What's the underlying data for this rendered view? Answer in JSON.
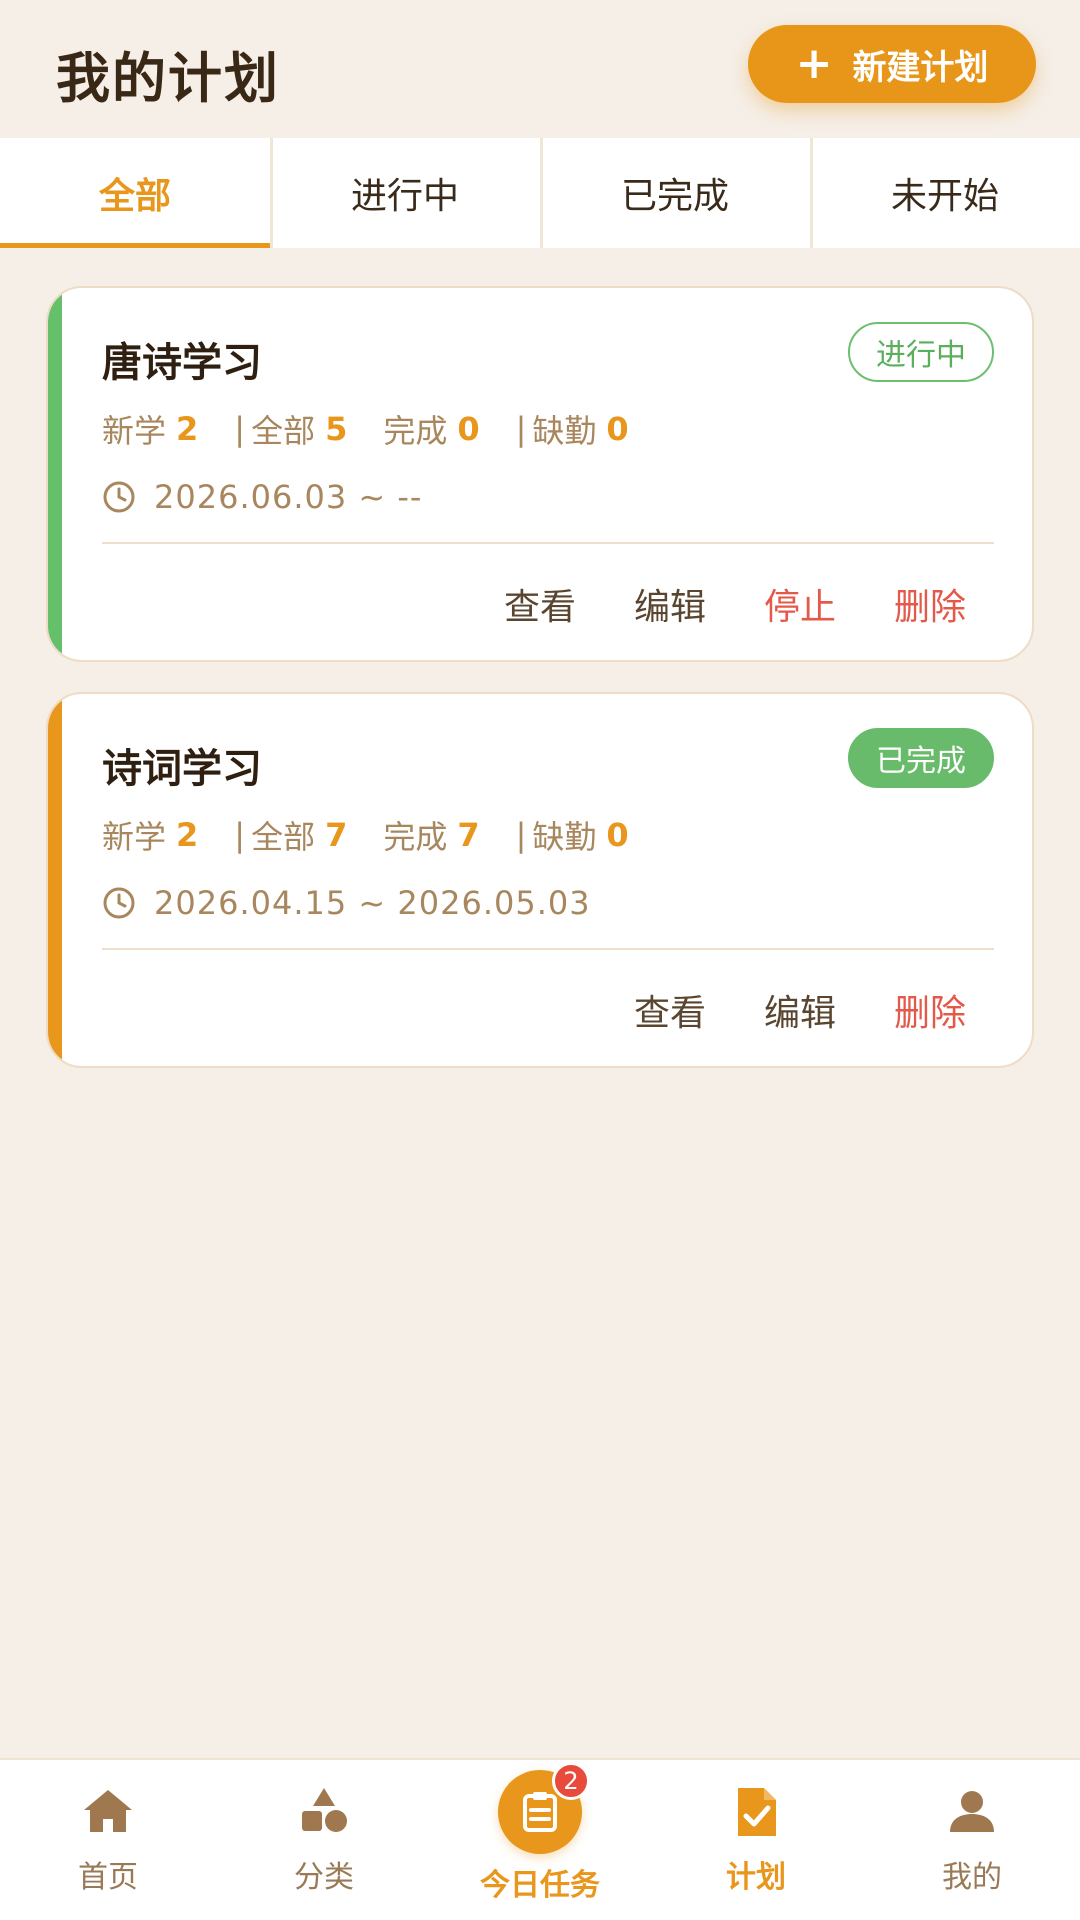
{
  "header": {
    "title": "我的计划",
    "new_plan_button": "新建计划"
  },
  "tabs": [
    {
      "label": "全部",
      "active": true
    },
    {
      "label": "进行中",
      "active": false
    },
    {
      "label": "已完成",
      "active": false
    },
    {
      "label": "未开始",
      "active": false
    }
  ],
  "plans": [
    {
      "title": "唐诗学习",
      "status": "进行中",
      "stripe_color": "#66bf6a",
      "stats": {
        "new_label": "新学",
        "new_value": "2",
        "sep": "|",
        "total_label": "全部",
        "total_value": "5",
        "done_label": "完成",
        "done_value": "0",
        "absent_label": "缺勤",
        "absent_value": "0"
      },
      "date_range": "2026.06.03 ~ --",
      "actions": [
        "查看",
        "编辑",
        "停止",
        "删除"
      ]
    },
    {
      "title": "诗词学习",
      "status": "已完成",
      "stripe_color": "#e8961c",
      "stats": {
        "new_label": "新学",
        "new_value": "2",
        "sep": "|",
        "total_label": "全部",
        "total_value": "7",
        "done_label": "完成",
        "done_value": "7",
        "absent_label": "缺勤",
        "absent_value": "0"
      },
      "date_range": "2026.04.15 ~ 2026.05.03",
      "actions": [
        "查看",
        "编辑",
        "删除"
      ]
    }
  ],
  "bottom_nav": {
    "items": [
      {
        "label": "首页",
        "icon": "home-icon"
      },
      {
        "label": "分类",
        "icon": "shapes-icon"
      },
      {
        "label": "今日任务",
        "icon": "clipboard-icon",
        "badge": "2"
      },
      {
        "label": "计划",
        "icon": "plan-doc-icon",
        "active": true
      },
      {
        "label": "我的",
        "icon": "user-icon"
      }
    ]
  },
  "colors": {
    "accent": "#e8961c",
    "success": "#66bf6a",
    "danger": "#e35a4a",
    "muted": "#a8875e"
  }
}
